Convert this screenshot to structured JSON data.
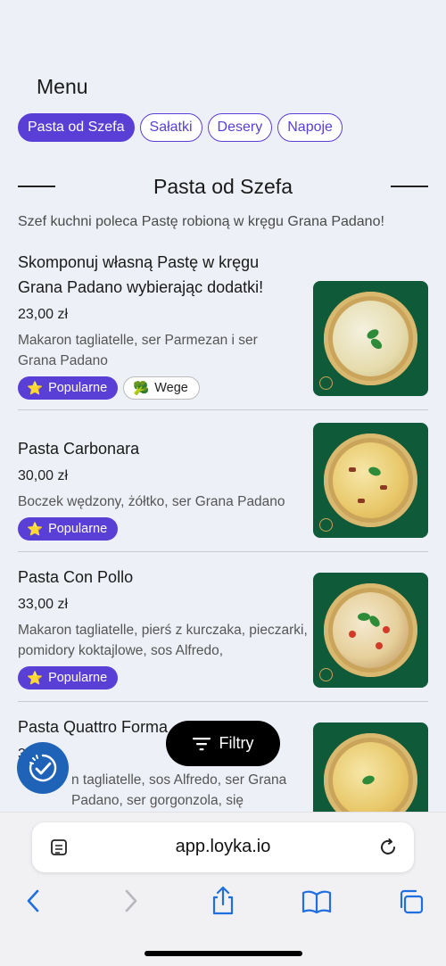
{
  "header": {
    "title": "Menu"
  },
  "tabs": [
    {
      "label": "Pasta od Szefa",
      "active": true
    },
    {
      "label": "Sałatki",
      "active": false
    },
    {
      "label": "Desery",
      "active": false
    },
    {
      "label": "Napoje",
      "active": false
    }
  ],
  "section": {
    "title": "Pasta od Szefa",
    "subtitle": "Szef kuchni poleca Pastę robioną w kręgu Grana Padano!"
  },
  "items": [
    {
      "name": "Skomponuj własną Pastę w kręgu Grana Padano wybierając dodatki!",
      "price": "23,00 zł",
      "description": "Makaron tagliatelle, ser Parmezan i ser Grana Padano",
      "badges": [
        {
          "icon": "star-icon",
          "label": "Popularne"
        },
        {
          "icon": "broccoli-icon",
          "label": "Wege"
        }
      ]
    },
    {
      "name": "Pasta Carbonara",
      "price": "30,00 zł",
      "description": "Boczek wędzony, żółtko, ser Grana Padano",
      "badges": [
        {
          "icon": "star-icon",
          "label": "Popularne"
        }
      ]
    },
    {
      "name": "Pasta Con Pollo",
      "price": "33,00 zł",
      "description": "Makaron tagliatelle, pierś z kurczaka, pieczarki, pomidory koktajlowe, sos Alfredo,",
      "badges": [
        {
          "icon": "star-icon",
          "label": "Popularne"
        }
      ]
    },
    {
      "name": "Pasta Quattro Forma",
      "price": "3",
      "description": "n tagliatelle, sos Alfredo, ser Grana Padano, ser gorgonzola, się mozzarella, ser"
    }
  ],
  "filters_button": {
    "label": "Filtry",
    "icon": "filter-icon"
  },
  "fab": {
    "icon": "clock-check-icon"
  },
  "browser": {
    "url": "app.loyka.io",
    "colors": {
      "accent": "#5a3fd6",
      "link": "#1f6fe0",
      "fab": "#1f63b8"
    }
  }
}
